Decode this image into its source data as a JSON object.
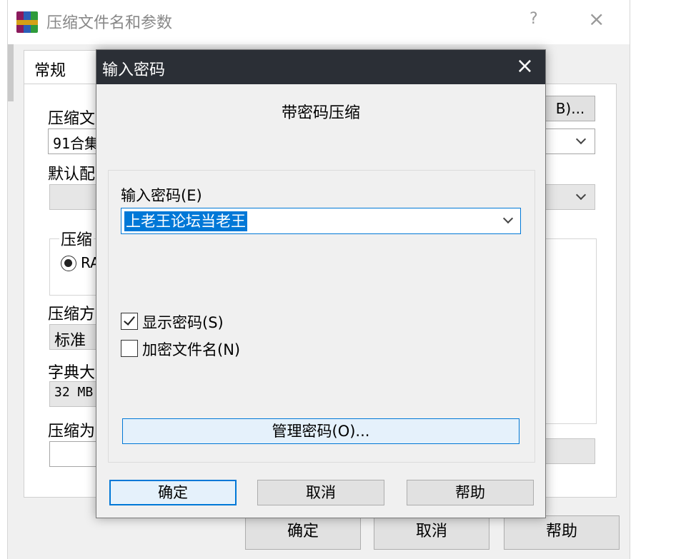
{
  "background_window": {
    "title": "压缩文件名和参数",
    "help_glyph": "?",
    "close_glyph": "×",
    "tab_general": "常规",
    "archive_name_label": "压缩文",
    "archive_name_value": "91合集",
    "browse_button": "B)...",
    "default_profile_label": "默认配",
    "format_group_label": "压缩",
    "format_rar_option": "RA",
    "method_label": "压缩方",
    "method_value": "标准",
    "dictionary_label": "字典大",
    "dictionary_value": "32 MB",
    "split_label": "压缩为",
    "ok_button": "确定",
    "cancel_button": "取消",
    "help_button": "帮助"
  },
  "dialog": {
    "title": "输入密码",
    "close_glyph": "×",
    "heading": "带密码压缩",
    "password_label": "输入密码(E)",
    "password_value": "上老王论坛当老王",
    "show_password_label": "显示密码(S)",
    "show_password_checked": true,
    "encrypt_filenames_label": "加密文件名(N)",
    "encrypt_filenames_checked": false,
    "manage_passwords_button": "管理密码(O)...",
    "ok_button": "确定",
    "cancel_button": "取消",
    "help_button": "帮助"
  },
  "colors": {
    "dialog_titlebar": "#2b2f36",
    "accent": "#0078d7",
    "dialog_background": "#f0f0f0"
  }
}
